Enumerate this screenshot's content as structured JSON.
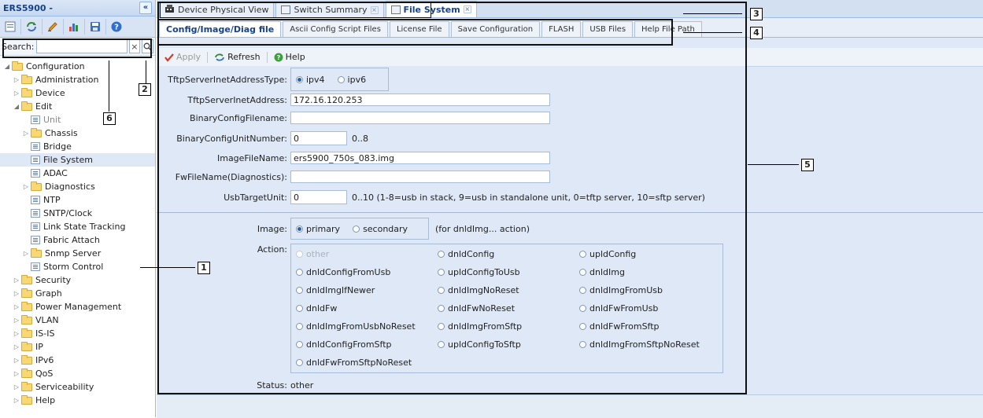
{
  "nav": {
    "title": "ERS5900 -",
    "collapse": "«",
    "search_label": "Search:",
    "search_value": "",
    "search_clear": "×",
    "toolbar_icons": [
      "page-icon",
      "refresh-icon",
      "edit-icon",
      "chart-icon",
      "save-icon",
      "help-icon"
    ],
    "tree": [
      {
        "label": "Configuration",
        "type": "folder",
        "expanded": true,
        "level": 0
      },
      {
        "label": "Administration",
        "type": "folder",
        "level": 1
      },
      {
        "label": "Device",
        "type": "folder",
        "level": 1
      },
      {
        "label": "Edit",
        "type": "folder",
        "expanded": true,
        "level": 1
      },
      {
        "label": "Unit",
        "type": "leaf",
        "level": 2,
        "disabled": true
      },
      {
        "label": "Chassis",
        "type": "folder",
        "level": 2
      },
      {
        "label": "Bridge",
        "type": "leaf",
        "level": 2
      },
      {
        "label": "File System",
        "type": "leaf",
        "level": 2,
        "selected": true
      },
      {
        "label": "ADAC",
        "type": "leaf",
        "level": 2
      },
      {
        "label": "Diagnostics",
        "type": "folder",
        "level": 2
      },
      {
        "label": "NTP",
        "type": "leaf",
        "level": 2
      },
      {
        "label": "SNTP/Clock",
        "type": "leaf",
        "level": 2
      },
      {
        "label": "Link State Tracking",
        "type": "leaf",
        "level": 2
      },
      {
        "label": "Fabric Attach",
        "type": "leaf",
        "level": 2
      },
      {
        "label": "Snmp Server",
        "type": "folder",
        "level": 2
      },
      {
        "label": "Storm Control",
        "type": "leaf",
        "level": 2
      },
      {
        "label": "Security",
        "type": "folder",
        "level": 1
      },
      {
        "label": "Graph",
        "type": "folder",
        "level": 1
      },
      {
        "label": "Power Management",
        "type": "folder",
        "level": 1
      },
      {
        "label": "VLAN",
        "type": "folder",
        "level": 1
      },
      {
        "label": "IS-IS",
        "type": "folder",
        "level": 1
      },
      {
        "label": "IP",
        "type": "folder",
        "level": 1
      },
      {
        "label": "IPv6",
        "type": "folder",
        "level": 1
      },
      {
        "label": "QoS",
        "type": "folder",
        "level": 1
      },
      {
        "label": "Serviceability",
        "type": "folder",
        "level": 1
      },
      {
        "label": "Help",
        "type": "folder",
        "level": 1
      }
    ]
  },
  "tabs": [
    {
      "label": "Device Physical View",
      "icon": "device-icon",
      "closable": false,
      "active": false
    },
    {
      "label": "Switch Summary",
      "icon": "list-icon",
      "closable": true,
      "active": false
    },
    {
      "label": "File System",
      "icon": "list-icon",
      "closable": true,
      "active": true
    }
  ],
  "subtabs": [
    {
      "label": "Config/Image/Diag file",
      "active": true
    },
    {
      "label": "Ascii Config Script Files"
    },
    {
      "label": "License File"
    },
    {
      "label": "Save Configuration"
    },
    {
      "label": "FLASH"
    },
    {
      "label": "USB Files"
    },
    {
      "label": "Help File Path"
    }
  ],
  "actions": {
    "apply": "Apply",
    "refresh": "Refresh",
    "help": "Help"
  },
  "form": {
    "inet_type": {
      "label": "TftpServerInetAddressType:",
      "options": [
        "ipv4",
        "ipv6"
      ],
      "selected": "ipv4"
    },
    "inet_address": {
      "label": "TftpServerInetAddress:",
      "value": "172.16.120.253"
    },
    "binary_filename": {
      "label": "BinaryConfigFilename:",
      "value": ""
    },
    "binary_unit": {
      "label": "BinaryConfigUnitNumber:",
      "value": "0",
      "hint": "0..8"
    },
    "image_file": {
      "label": "ImageFileName:",
      "value": "ers5900_750s_083.img"
    },
    "fw_file": {
      "label": "FwFileName(Diagnostics):",
      "value": ""
    },
    "usb_unit": {
      "label": "UsbTargetUnit:",
      "value": "0",
      "hint": "0..10 (1-8=usb in stack, 9=usb in standalone unit, 0=tftp server, 10=sftp server)"
    },
    "image": {
      "label": "Image:",
      "options": [
        "primary",
        "secondary"
      ],
      "selected": "primary",
      "note": "(for dnldImg... action)"
    },
    "action": {
      "label": "Action:",
      "selected": "other",
      "options": [
        "other",
        "dnldConfig",
        "upldConfig",
        "dnldConfigFromUsb",
        "upldConfigToUsb",
        "dnldImg",
        "dnldImgIfNewer",
        "dnldImgNoReset",
        "dnldImgFromUsb",
        "dnldFw",
        "dnldFwNoReset",
        "dnldFwFromUsb",
        "dnldImgFromUsbNoReset",
        "dnldImgFromSftp",
        "dnldFwFromSftp",
        "dnldConfigFromSftp",
        "upldConfigToSftp",
        "dnldImgFromSftpNoReset",
        "dnldFwFromSftpNoReset"
      ]
    },
    "status": {
      "label": "Status:",
      "value": "other"
    }
  },
  "callouts": [
    "1",
    "2",
    "3",
    "4",
    "5",
    "6"
  ]
}
